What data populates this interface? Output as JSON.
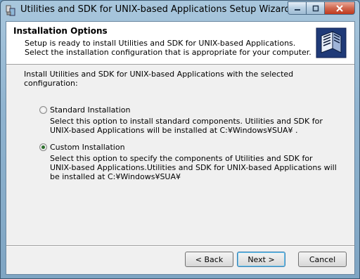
{
  "window": {
    "title": "Utilities and SDK for UNIX-based Applications Setup Wizard"
  },
  "header": {
    "title": "Installation Options",
    "subtitle_line1": "Setup is ready to install Utilities and SDK for UNIX-based Applications.",
    "subtitle_line2": "Select the installation configuration that is appropriate for your computer."
  },
  "main": {
    "intro_line1": "Install Utilities and SDK for UNIX-based Applications with the selected",
    "intro_line2": "configuration:",
    "options": [
      {
        "label": "Standard Installation",
        "selected": false,
        "desc_line1": "Select this option to install standard components. Utilities and SDK for",
        "desc_line2": "UNIX-based Applications will be installed at C:¥Windows¥SUA¥ ."
      },
      {
        "label": "Custom Installation",
        "selected": true,
        "desc_line1": "Select this option to specify the components  of Utilities and SDK for",
        "desc_line2": "UNIX-based Applications.Utilities and SDK for UNIX-based Applications will",
        "desc_line3": "be installed at C:¥Windows¥SUA¥"
      }
    ]
  },
  "footer": {
    "back": "< Back",
    "next": "Next >",
    "cancel": "Cancel"
  },
  "icons": {
    "app": "installer-app-icon",
    "header": "server-icon",
    "minimize": "minimize-icon",
    "maximize": "maximize-icon",
    "close": "close-icon"
  }
}
